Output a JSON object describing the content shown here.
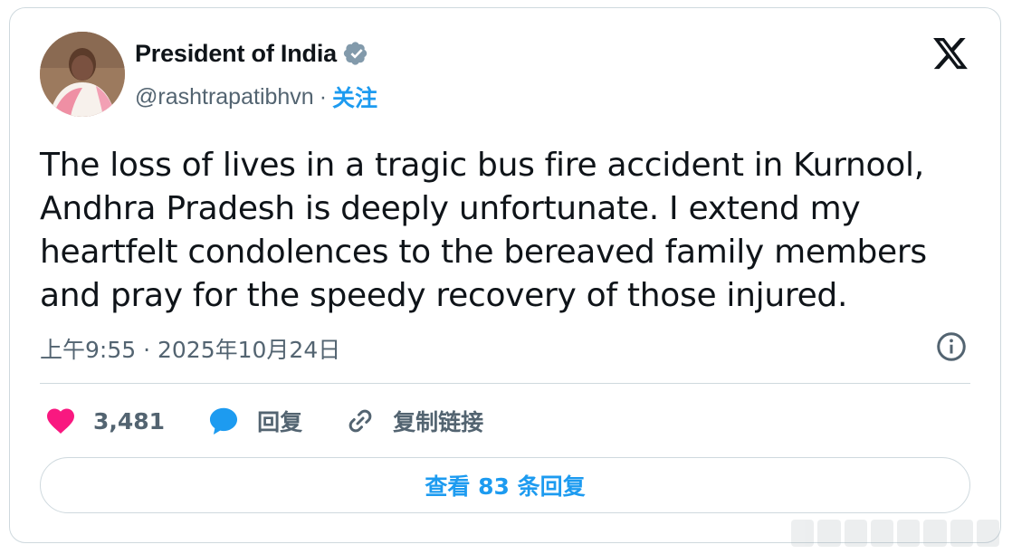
{
  "author": {
    "name": "President of India",
    "handle": "@rashtrapatibhvn",
    "separator": "·",
    "follow_label": "关注",
    "verified_icon": "verified-badge-icon"
  },
  "tweet": {
    "text": "The loss of lives in a tragic bus fire accident in Kurnool, Andhra Pradesh is deeply unfortunate. I extend my heartfelt condolences to the bereaved family members and pray for the speedy recovery of those injured.",
    "timestamp": "上午9:55 · 2025年10月24日"
  },
  "actions": {
    "likes_count": "3,481",
    "reply_label": "回复",
    "copy_link_label": "复制链接"
  },
  "replies_button": {
    "label": "查看 83 条回复"
  },
  "colors": {
    "accent": "#1d9bf0",
    "like": "#f91880",
    "text": "#0f1419",
    "muted": "#536471",
    "border": "#cfd9de"
  },
  "icons": [
    "x-logo-icon",
    "verified-badge-icon",
    "info-icon",
    "heart-icon",
    "reply-bubble-icon",
    "link-icon"
  ]
}
